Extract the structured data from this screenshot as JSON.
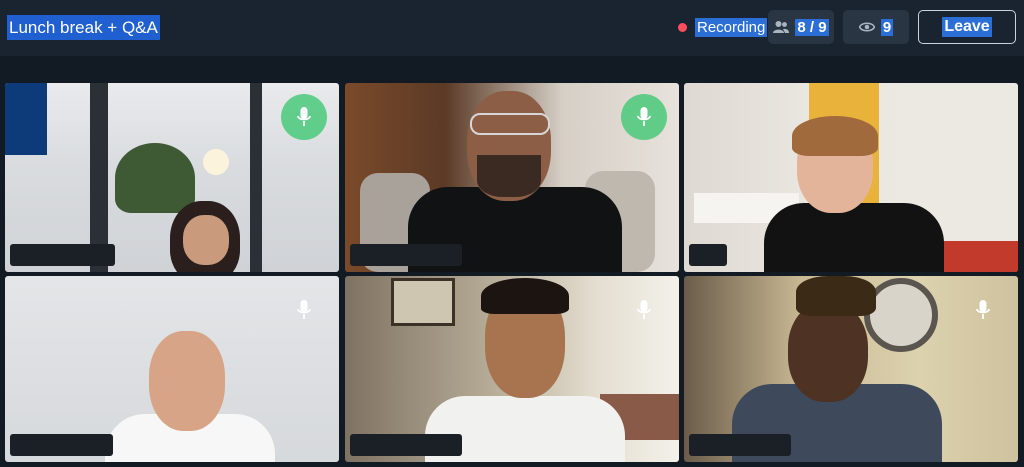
{
  "header": {
    "title": "Lunch break + Q&A",
    "recording_label": "Recording",
    "participants_count": "8 / 9",
    "viewers_count": "9",
    "leave_label": "Leave",
    "icons": {
      "recording": "recording-dot-icon",
      "participants": "people-icon",
      "viewers": "eye-icon"
    }
  },
  "tiles": [
    {
      "id": "tile-1",
      "mic": "active"
    },
    {
      "id": "tile-2",
      "mic": "active"
    },
    {
      "id": "tile-3",
      "mic": "none"
    },
    {
      "id": "tile-4",
      "mic": "idle"
    },
    {
      "id": "tile-5",
      "mic": "idle"
    },
    {
      "id": "tile-6",
      "mic": "idle"
    }
  ],
  "colors": {
    "background": "#121a24",
    "topbar": "#1a2330",
    "selection": "#2b6fd6",
    "recording_dot": "#ff4d5e",
    "mic_active": "#4ac97a"
  }
}
